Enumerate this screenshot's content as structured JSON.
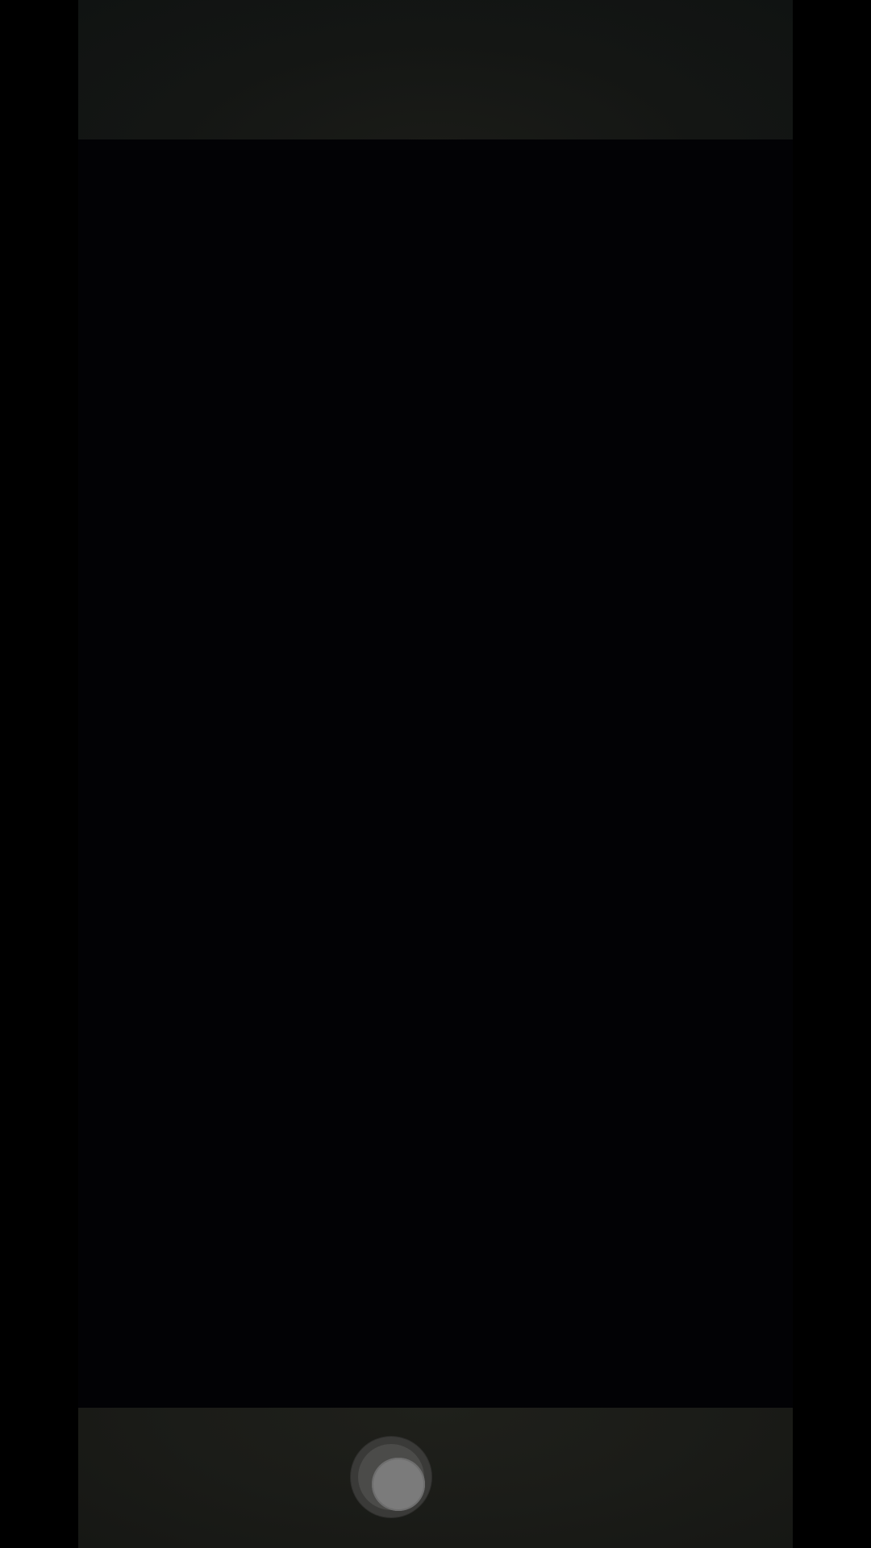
{
  "app": {
    "screen": "camera-viewfinder"
  },
  "controls": {
    "shutter_icon": "shutter-button-icon"
  },
  "colors": {
    "background": "#000000",
    "viewfinder": "#020205",
    "bar": "#1b1c18",
    "shutter": "#7b7b7b"
  }
}
